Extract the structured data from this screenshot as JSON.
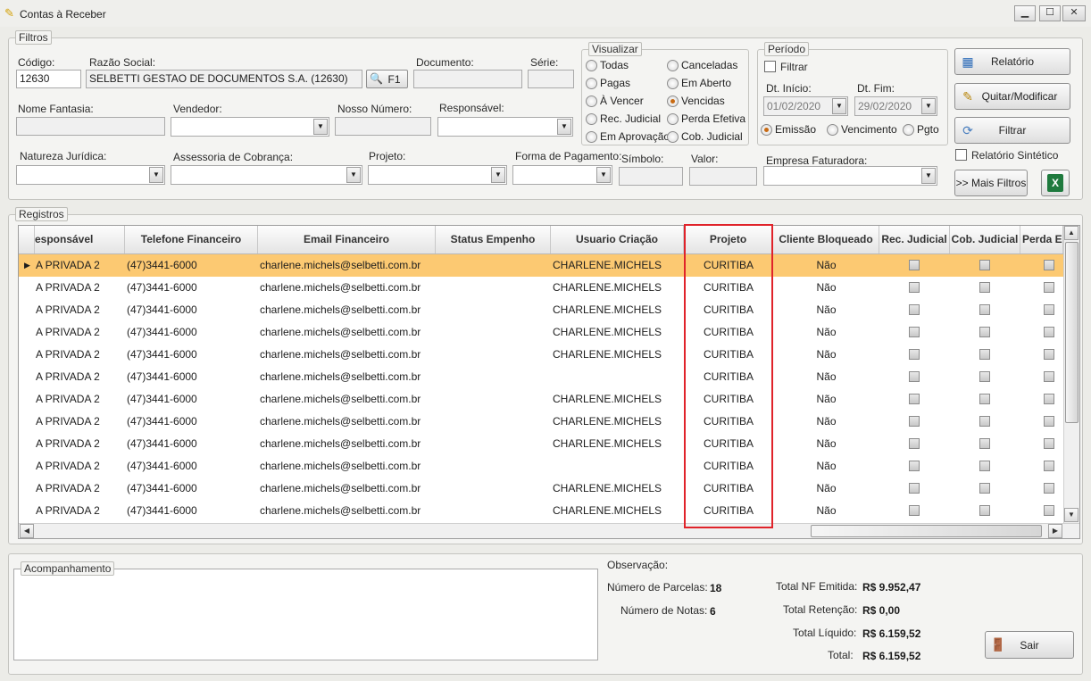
{
  "window": {
    "title": "Contas à Receber",
    "min": "▁",
    "max": "☐",
    "close": "✕"
  },
  "filtros": {
    "legend": "Filtros",
    "codigo_label": "Código:",
    "codigo_value": "12630",
    "razao_label": "Razão Social:",
    "razao_value": "SELBETTI GESTAO DE DOCUMENTOS S.A. (12630)",
    "f1_label": "F1",
    "documento_label": "Documento:",
    "serie_label": "Série:",
    "nome_fantasia_label": "Nome Fantasia:",
    "vendedor_label": "Vendedor:",
    "nosso_numero_label": "Nosso Número:",
    "responsavel_label": "Responsável:",
    "natureza_label": "Natureza Jurídica:",
    "assessoria_label": "Assessoria de Cobrança:",
    "projeto_label": "Projeto:",
    "forma_pagamento_label": "Forma de Pagamento:",
    "simbolo_label": "Símbolo:",
    "valor_label": "Valor:",
    "empresa_label": "Empresa Faturadora:"
  },
  "visualizar": {
    "legend": "Visualizar",
    "options": [
      {
        "label": "Todas",
        "checked": false
      },
      {
        "label": "Canceladas",
        "checked": false
      },
      {
        "label": "Pagas",
        "checked": false
      },
      {
        "label": "Em Aberto",
        "checked": false
      },
      {
        "label": "À Vencer",
        "checked": false
      },
      {
        "label": "Vencidas",
        "checked": true
      },
      {
        "label": "Rec. Judicial",
        "checked": false
      },
      {
        "label": "Perda Efetiva",
        "checked": false
      },
      {
        "label": "Em Aprovação",
        "checked": false
      },
      {
        "label": "Cob. Judicial",
        "checked": false
      }
    ]
  },
  "periodo": {
    "legend": "Período",
    "filtrar_label": "Filtrar",
    "dt_inicio_label": "Dt. Início:",
    "dt_inicio_value": "01/02/2020",
    "dt_fim_label": "Dt. Fim:",
    "dt_fim_value": "29/02/2020",
    "emissao_label": "Emissão",
    "vencimento_label": "Vencimento",
    "pgto_label": "Pgto"
  },
  "actions": {
    "relatorio": "Relatório",
    "quitar": "Quitar/Modificar",
    "filtrar": "Filtrar",
    "relatorio_sintetico": "Relatório Sintético",
    "mais_filtros": ">> Mais Filtros"
  },
  "registros": {
    "legend": "Registros",
    "columns": [
      "esponsável",
      "Telefone Financeiro",
      "Email Financeiro",
      "Status Empenho",
      "Usuario Criação",
      "Projeto",
      "Cliente Bloqueado",
      "Rec. Judicial",
      "Cob. Judicial",
      "Perda Ef"
    ],
    "rows": [
      {
        "responsavel": "A PRIVADA 2",
        "telefone": "(47)3441-6000",
        "email": "charlene.michels@selbetti.com.br",
        "usuario": "CHARLENE.MICHELS",
        "projeto": "CURITIBA",
        "bloqueado": "Não"
      },
      {
        "responsavel": "A PRIVADA 2",
        "telefone": "(47)3441-6000",
        "email": "charlene.michels@selbetti.com.br",
        "usuario": "CHARLENE.MICHELS",
        "projeto": "CURITIBA",
        "bloqueado": "Não"
      },
      {
        "responsavel": "A PRIVADA 2",
        "telefone": "(47)3441-6000",
        "email": "charlene.michels@selbetti.com.br",
        "usuario": "CHARLENE.MICHELS",
        "projeto": "CURITIBA",
        "bloqueado": "Não"
      },
      {
        "responsavel": "A PRIVADA 2",
        "telefone": "(47)3441-6000",
        "email": "charlene.michels@selbetti.com.br",
        "usuario": "CHARLENE.MICHELS",
        "projeto": "CURITIBA",
        "bloqueado": "Não"
      },
      {
        "responsavel": "A PRIVADA 2",
        "telefone": "(47)3441-6000",
        "email": "charlene.michels@selbetti.com.br",
        "usuario": "CHARLENE.MICHELS",
        "projeto": "CURITIBA",
        "bloqueado": "Não"
      },
      {
        "responsavel": "A PRIVADA 2",
        "telefone": "(47)3441-6000",
        "email": "charlene.michels@selbetti.com.br",
        "usuario": "",
        "projeto": "CURITIBA",
        "bloqueado": "Não"
      },
      {
        "responsavel": "A PRIVADA 2",
        "telefone": "(47)3441-6000",
        "email": "charlene.michels@selbetti.com.br",
        "usuario": "CHARLENE.MICHELS",
        "projeto": "CURITIBA",
        "bloqueado": "Não"
      },
      {
        "responsavel": "A PRIVADA 2",
        "telefone": "(47)3441-6000",
        "email": "charlene.michels@selbetti.com.br",
        "usuario": "CHARLENE.MICHELS",
        "projeto": "CURITIBA",
        "bloqueado": "Não"
      },
      {
        "responsavel": "A PRIVADA 2",
        "telefone": "(47)3441-6000",
        "email": "charlene.michels@selbetti.com.br",
        "usuario": "CHARLENE.MICHELS",
        "projeto": "CURITIBA",
        "bloqueado": "Não"
      },
      {
        "responsavel": "A PRIVADA 2",
        "telefone": "(47)3441-6000",
        "email": "charlene.michels@selbetti.com.br",
        "usuario": "",
        "projeto": "CURITIBA",
        "bloqueado": "Não"
      },
      {
        "responsavel": "A PRIVADA 2",
        "telefone": "(47)3441-6000",
        "email": "charlene.michels@selbetti.com.br",
        "usuario": "CHARLENE.MICHELS",
        "projeto": "CURITIBA",
        "bloqueado": "Não"
      },
      {
        "responsavel": "A PRIVADA 2",
        "telefone": "(47)3441-6000",
        "email": "charlene.michels@selbetti.com.br",
        "usuario": "CHARLENE.MICHELS",
        "projeto": "CURITIBA",
        "bloqueado": "Não"
      }
    ]
  },
  "acompanhamento": {
    "legend": "Acompanhamento"
  },
  "observacao": {
    "label": "Observação:",
    "parcelas_label": "Número de Parcelas:",
    "parcelas_value": "18",
    "notas_label": "Número de Notas:",
    "notas_value": "6",
    "nf_label": "Total NF Emitida:",
    "nf_value": "R$ 9.952,47",
    "retencao_label": "Total Retenção:",
    "retencao_value": "R$ 0,00",
    "liquido_label": "Total Líquido:",
    "liquido_value": "R$ 6.159,52",
    "total_label": "Total:",
    "total_value": "R$ 6.159,52"
  },
  "sair_label": "Sair",
  "colors": {
    "selected_row": "#fcc972",
    "highlight_border": "#e0232a"
  }
}
